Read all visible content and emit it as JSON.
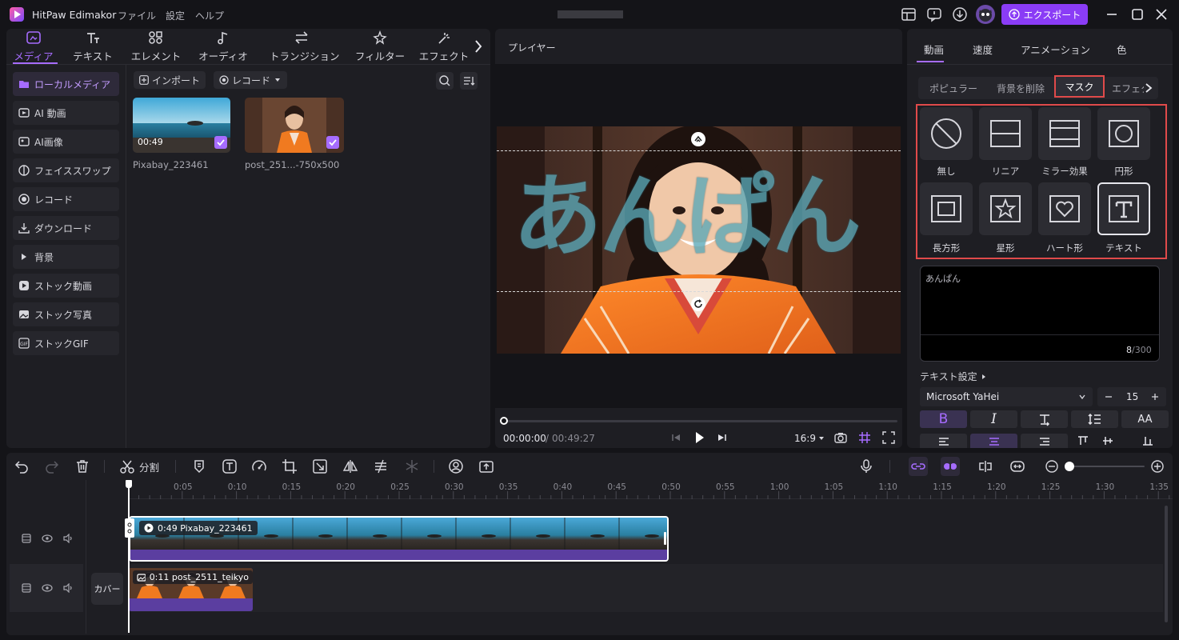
{
  "app": {
    "title": "HitPaw Edimakor",
    "menu": [
      "ファイル",
      "設定",
      "ヘルプ"
    ],
    "export_label": "エクスポート",
    "accent": "#8a3cf6",
    "icons": [
      "layout-icon",
      "feedback-icon",
      "download-icon",
      "avatar",
      "minimize-icon",
      "maximize-icon",
      "close-icon"
    ]
  },
  "media_tabs": {
    "items": [
      {
        "label": "メディア",
        "icon": "media-icon",
        "active": true
      },
      {
        "label": "テキスト",
        "icon": "text-icon"
      },
      {
        "label": "エレメント",
        "icon": "element-icon"
      },
      {
        "label": "オーディオ",
        "icon": "audio-icon"
      },
      {
        "label": "トランジション",
        "icon": "transition-icon"
      },
      {
        "label": "フィルター",
        "icon": "filter-icon"
      },
      {
        "label": "エフェクト",
        "icon": "effect-icon"
      }
    ]
  },
  "sidebar": {
    "items": [
      {
        "label": "ローカルメディア",
        "icon": "folder-icon",
        "active": true
      },
      {
        "label": "AI 動画",
        "icon": "ai-video-icon"
      },
      {
        "label": "AI画像",
        "icon": "ai-image-icon"
      },
      {
        "label": "フェイススワップ",
        "icon": "faceswap-icon"
      },
      {
        "label": "レコード",
        "icon": "record-icon"
      },
      {
        "label": "ダウンロード",
        "icon": "download-icon"
      },
      {
        "label": "背景",
        "icon": "triangle-icon"
      },
      {
        "label": "ストック動画",
        "icon": "stock-video-icon"
      },
      {
        "label": "ストック写真",
        "icon": "stock-photo-icon"
      },
      {
        "label": "ストックGIF",
        "icon": "gif-icon"
      }
    ]
  },
  "media_toolbar": {
    "import_label": "インポート",
    "record_label": "レコード"
  },
  "media_items": [
    {
      "name": "Pixabay_223461",
      "duration": "00:49"
    },
    {
      "name": "post_251...-750x500",
      "duration": ""
    }
  ],
  "player": {
    "title": "プレイヤー",
    "overlay_text": "あんぱん",
    "current_time": "00:00:00",
    "separator": "/",
    "total_time": "00:49:27",
    "aspect_ratio": "16:9",
    "progress": 0
  },
  "right_panel": {
    "tabs": [
      "動画",
      "速度",
      "アニメーション",
      "色"
    ],
    "active_tab": "動画",
    "subtabs": [
      "ポピュラー",
      "背景を削除",
      "マスク",
      "エフェクト"
    ],
    "active_subtab": "マスク",
    "masks": [
      {
        "label": "無し",
        "icon": "none-mask-icon"
      },
      {
        "label": "リニア",
        "icon": "linear-mask-icon"
      },
      {
        "label": "ミラー効果",
        "icon": "mirror-mask-icon"
      },
      {
        "label": "円形",
        "icon": "circle-mask-icon"
      },
      {
        "label": "長方形",
        "icon": "rectangle-mask-icon"
      },
      {
        "label": "星形",
        "icon": "star-mask-icon"
      },
      {
        "label": "ハート形",
        "icon": "heart-mask-icon"
      },
      {
        "label": "テキスト",
        "icon": "text-mask-icon"
      }
    ],
    "selected_mask": "テキスト",
    "text_value": "あんぱん",
    "char_count": "8",
    "char_max": "/300",
    "text_settings_label": "テキスト設定",
    "font_name": "Microsoft YaHei",
    "font_size": "15",
    "format_buttons": {
      "bold": "B",
      "italic": "I",
      "caps": "AA"
    }
  },
  "timeline": {
    "toolbar": {
      "split_label": "分割"
    },
    "ruler": [
      "0:05",
      "0:10",
      "0:15",
      "0:20",
      "0:25",
      "0:30",
      "0:35",
      "0:40",
      "0:45",
      "0:50",
      "0:55",
      "1:00",
      "1:05",
      "1:10",
      "1:15",
      "1:20",
      "1:25",
      "1:30",
      "1:35"
    ],
    "clip1_label": "0:49 Pixabay_223461",
    "clip2_label": "0:11 post_2511_teikyo",
    "cover_label": "カバー"
  }
}
